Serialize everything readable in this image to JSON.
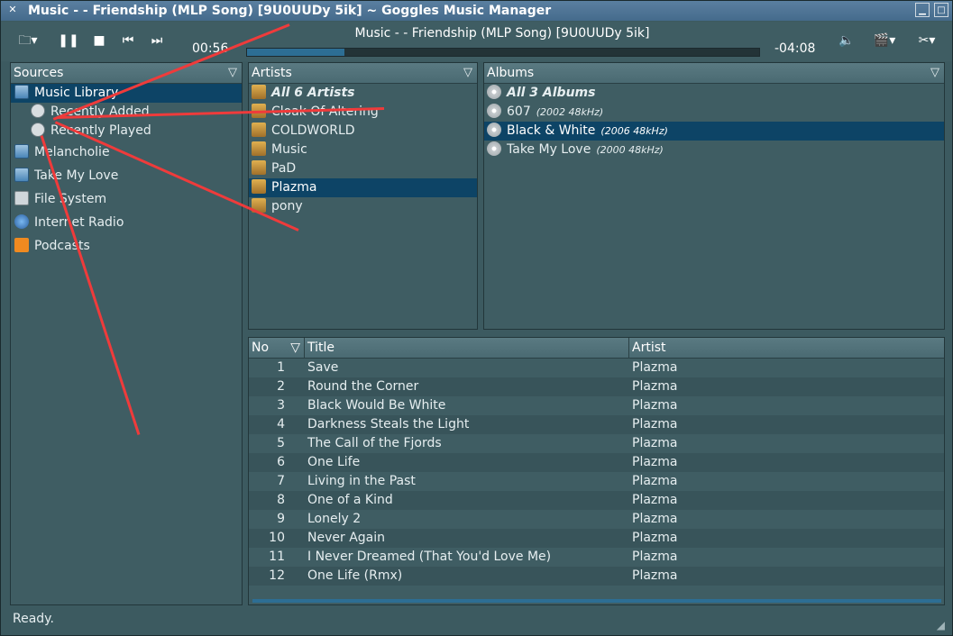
{
  "window": {
    "title": "Music - - Friendship (MLP Song) [9U0UUDy 5ik] ~ Goggles Music Manager"
  },
  "player": {
    "now_playing": "Music - - Friendship (MLP Song) [9U0UUDy 5ik]",
    "elapsed": "00:56",
    "remaining": "-04:08",
    "progress_fraction": 0.19
  },
  "sources": {
    "header": "Sources",
    "items": [
      {
        "label": "Music Library",
        "icon": "folder-icon"
      },
      {
        "label": "Recently Added",
        "icon": "search-icon"
      },
      {
        "label": "Recently Played",
        "icon": "search-icon"
      },
      {
        "label": "Melancholie",
        "icon": "folder-icon"
      },
      {
        "label": "Take My Love",
        "icon": "folder-icon"
      },
      {
        "label": "File System",
        "icon": "disk-icon"
      },
      {
        "label": "Internet Radio",
        "icon": "globe-icon"
      },
      {
        "label": "Podcasts",
        "icon": "rss-icon"
      }
    ]
  },
  "artists": {
    "header": "Artists",
    "items": [
      "All 6 Artists",
      "Cloak Of Altering",
      "COLDWORLD",
      "Music",
      "PaD",
      "Plazma",
      "pony"
    ]
  },
  "albums": {
    "header": "Albums",
    "items": [
      {
        "name": "All 3 Albums",
        "meta": ""
      },
      {
        "name": "607",
        "meta": "(2002 48kHz)"
      },
      {
        "name": "Black & White",
        "meta": "(2006 48kHz)"
      },
      {
        "name": "Take My Love",
        "meta": "(2000 48kHz)"
      }
    ]
  },
  "tracks": {
    "columns": {
      "no": "No",
      "title": "Title",
      "artist": "Artist"
    },
    "rows": [
      {
        "no": "1",
        "title": "Save",
        "artist": "Plazma"
      },
      {
        "no": "2",
        "title": "Round the Corner",
        "artist": "Plazma"
      },
      {
        "no": "3",
        "title": "Black Would Be White",
        "artist": "Plazma"
      },
      {
        "no": "4",
        "title": "Darkness Steals the Light",
        "artist": "Plazma"
      },
      {
        "no": "5",
        "title": "The Call of the Fjords",
        "artist": "Plazma"
      },
      {
        "no": "6",
        "title": "One Life",
        "artist": "Plazma"
      },
      {
        "no": "7",
        "title": "Living in the Past",
        "artist": "Plazma"
      },
      {
        "no": "8",
        "title": "One of a Kind",
        "artist": "Plazma"
      },
      {
        "no": "9",
        "title": "Lonely 2",
        "artist": "Plazma"
      },
      {
        "no": "10",
        "title": "Never Again",
        "artist": "Plazma"
      },
      {
        "no": "11",
        "title": "I Never Dreamed (That You'd Love Me)",
        "artist": "Plazma"
      },
      {
        "no": "12",
        "title": "One Life (Rmx)",
        "artist": "Plazma"
      }
    ]
  },
  "status": "Ready.",
  "colors": {
    "selection": "#0d4466",
    "annotation": "#ef3b3b"
  }
}
